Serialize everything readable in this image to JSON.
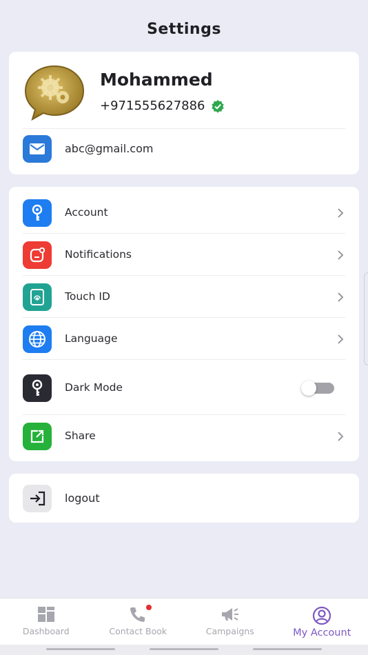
{
  "header": {
    "title": "Settings"
  },
  "profile": {
    "name": "Mohammed",
    "phone": "+971555627886",
    "email": "abc@gmail.com",
    "verified_color": "#2fa84f"
  },
  "menu": {
    "account": {
      "label": "Account",
      "icon": "key-icon",
      "color": "#1e7df0"
    },
    "notifications": {
      "label": "Notifications",
      "icon": "notification-icon",
      "color": "#ee3b33"
    },
    "touch_id": {
      "label": "Touch ID",
      "icon": "fingerprint-icon",
      "color": "#21a394"
    },
    "language": {
      "label": "Language",
      "icon": "globe-icon",
      "color": "#1e7df0"
    },
    "dark_mode": {
      "label": "Dark Mode",
      "icon": "key-icon",
      "color": "#2a2a33",
      "enabled": false
    },
    "share": {
      "label": "Share",
      "icon": "share-icon",
      "color": "#25b13a"
    }
  },
  "logout": {
    "label": "logout",
    "icon": "logout-icon"
  },
  "tabs": [
    {
      "label": "Dashboard",
      "icon": "dashboard-icon",
      "active": false
    },
    {
      "label": "Contact Book",
      "icon": "phone-icon",
      "active": false,
      "badge": true
    },
    {
      "label": "Campaigns",
      "icon": "megaphone-icon",
      "active": false
    },
    {
      "label": "My Account",
      "icon": "user-icon",
      "active": true
    }
  ],
  "colors": {
    "accent": "#7c58c4",
    "background": "#ebebf5"
  }
}
